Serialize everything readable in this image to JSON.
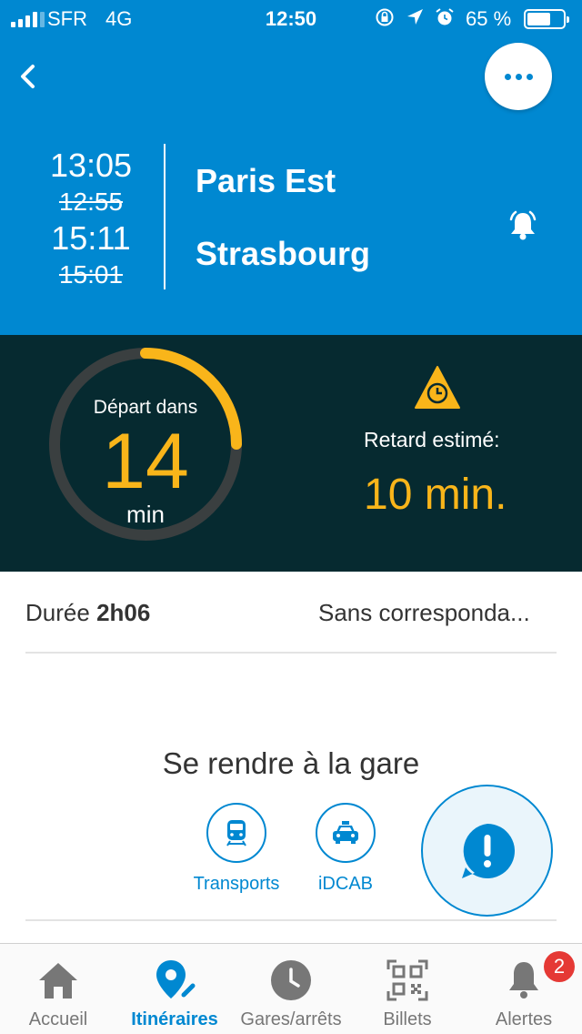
{
  "status_bar": {
    "carrier": "SFR",
    "network": "4G",
    "time": "12:50",
    "battery_percent": "65 %",
    "battery_level": 0.65,
    "signal_bars": 4,
    "icons": [
      "rotation-lock-icon",
      "location-arrow-icon",
      "alarm-clock-icon"
    ]
  },
  "header": {
    "departure_time": "13:05",
    "departure_time_scheduled": "12:55",
    "arrival_time": "15:11",
    "arrival_time_scheduled": "15:01",
    "origin": "Paris Est",
    "destination": "Strasbourg"
  },
  "departure": {
    "label": "Départ dans",
    "minutes": "14",
    "unit": "min",
    "progress": 0.25,
    "delay_label": "Retard estimé:",
    "delay_value": "10 min."
  },
  "info": {
    "duration_label": "Durée",
    "duration_value": "2h06",
    "connections": "Sans corresponda..."
  },
  "access": {
    "title": "Se rendre à la gare",
    "buttons": [
      {
        "label": "Transports",
        "icon": "train-icon"
      },
      {
        "label": "iDCAB",
        "icon": "taxi-icon"
      }
    ]
  },
  "tab_bar": {
    "tabs": [
      {
        "label": "Accueil",
        "icon": "home-icon"
      },
      {
        "label": "Itinéraires",
        "icon": "route-pin-icon",
        "active": true
      },
      {
        "label": "Gares/arrêts",
        "icon": "clock-icon"
      },
      {
        "label": "Billets",
        "icon": "qr-code-icon"
      },
      {
        "label": "Alertes",
        "icon": "bell-icon",
        "badge": "2"
      }
    ]
  },
  "colors": {
    "primary": "#0088d1",
    "accent": "#f9b51a",
    "dark_panel": "#062a30",
    "badge": "#e53935"
  }
}
